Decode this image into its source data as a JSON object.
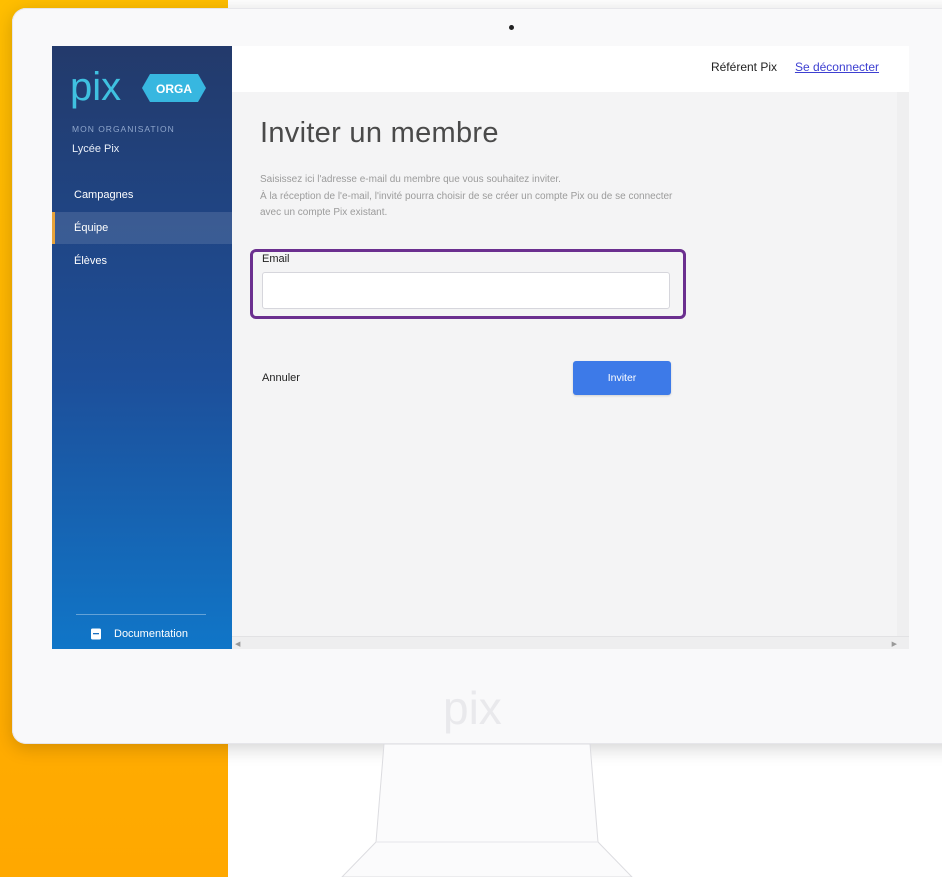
{
  "brand": {
    "logo_text": "pix",
    "logo_badge": "ORGA",
    "bezel_logo_text": "pix",
    "colors": {
      "yellow": "#ffb000",
      "sidebar_top": "#233a6b",
      "sidebar_bottom": "#1076c8",
      "primary_button": "#3d7ae8",
      "highlight": "#6b2f8f",
      "link": "#3d3fd1"
    }
  },
  "sidebar": {
    "org_label": "MON ORGANISATION",
    "org_name": "Lycée Pix",
    "items": [
      {
        "label": "Campagnes",
        "active": false
      },
      {
        "label": "Équipe",
        "active": true
      },
      {
        "label": "Élèves",
        "active": false
      }
    ],
    "documentation": {
      "label": "Documentation",
      "icon": "book-icon"
    }
  },
  "topbar": {
    "user_name": "Référent Pix",
    "logout_label": "Se déconnecter"
  },
  "main": {
    "title": "Inviter un membre",
    "description_lines": [
      "Saisissez ici l'adresse e-mail du membre que vous souhaitez inviter.",
      "À la réception de l'e-mail, l'invité pourra choisir de se créer un compte Pix ou de se connecter",
      "avec un compte Pix existant."
    ],
    "email_label": "Email",
    "email_value": "",
    "email_placeholder": "",
    "cancel_label": "Annuler",
    "invite_label": "Inviter"
  }
}
